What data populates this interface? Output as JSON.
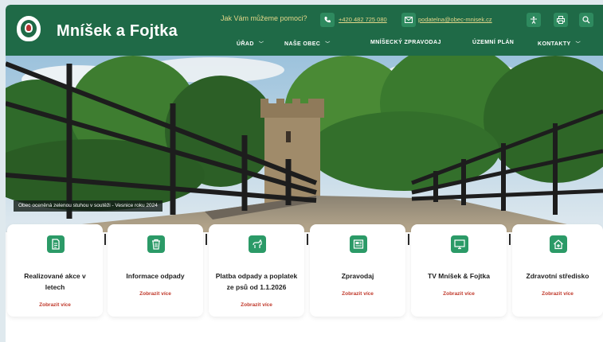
{
  "header": {
    "brand": "Mníšek a Fojtka",
    "help_text": "Jak Vám můžeme pomoci?",
    "phone": "+420 482 725 080",
    "email": "podatelna@obec-mnisek.cz",
    "icons": [
      "phone-icon",
      "mail-icon",
      "accessibility-icon",
      "print-icon",
      "search-icon"
    ]
  },
  "nav": {
    "items": [
      {
        "label": "ÚŘAD",
        "dropdown": true
      },
      {
        "label": "NAŠE OBEC",
        "dropdown": true
      },
      {
        "label": "MNÍŠECKÝ ZPRAVODAJ",
        "dropdown": false
      },
      {
        "label": "ÚZEMNÍ PLÁN",
        "dropdown": false
      },
      {
        "label": "KONTAKTY",
        "dropdown": true
      }
    ]
  },
  "hero": {
    "caption": "Obec oceněná zelenou stuhou v soutěži - Vesnice roku 2024"
  },
  "cards": [
    {
      "title_line1": "Realizované akce v",
      "title_line2": "letech",
      "more": "Zobrazit více",
      "icon": "document-icon"
    },
    {
      "title_line1": "Informace odpady",
      "title_line2": "",
      "more": "Zobrazit více",
      "icon": "trash-icon"
    },
    {
      "title_line1": "Platba odpady a poplatek",
      "title_line2": "ze psů od 1.1.2026",
      "more": "Zobrazit více",
      "icon": "dog-icon"
    },
    {
      "title_line1": "Zpravodaj",
      "title_line2": "",
      "more": "Zobrazit více",
      "icon": "newspaper-icon"
    },
    {
      "title_line1": "TV Mníšek & Fojtka",
      "title_line2": "",
      "more": "Zobrazit více",
      "icon": "tv-icon"
    },
    {
      "title_line1": "Zdravotní středisko",
      "title_line2": "",
      "more": "Zobrazit více",
      "icon": "health-house-icon"
    }
  ],
  "colors": {
    "header": "#1f6a47",
    "accent": "#2b9a67",
    "link": "#c0392b",
    "contact": "#e4d78a"
  }
}
